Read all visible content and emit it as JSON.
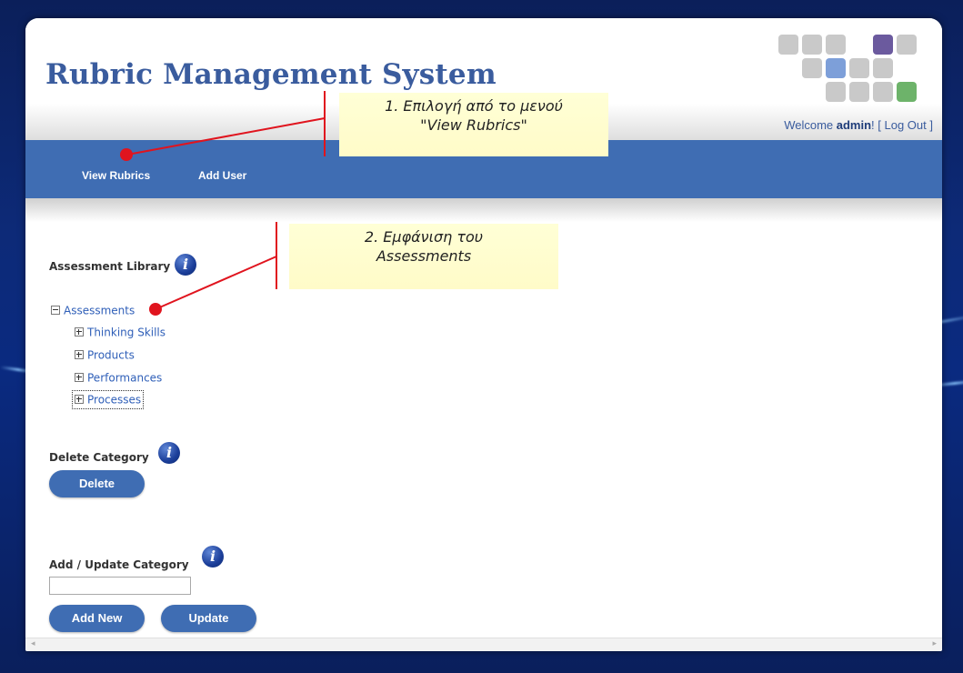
{
  "app": {
    "title": "Rubric Management System",
    "welcome_prefix": "Welcome ",
    "user": "admin",
    "welcome_sep": "! [ ",
    "logout_label": "Log Out",
    "welcome_suffix": " ]"
  },
  "nav": {
    "items": [
      {
        "label": "View Rubrics"
      },
      {
        "label": "Add User"
      }
    ]
  },
  "library": {
    "label": "Assessment Library",
    "tree_root": "Assessments",
    "tree_children": [
      "Thinking Skills",
      "Products",
      "Performances",
      "Processes"
    ]
  },
  "delete_category": {
    "label": "Delete Category",
    "button": "Delete"
  },
  "add_update_category": {
    "label": "Add / Update Category",
    "input_value": "",
    "add_button": "Add New",
    "update_button": "Update"
  },
  "annotations": {
    "step1": "1. Επιλογή από το μενού\n\"View Rubrics\"",
    "step2": "2. Εμφάνιση του\nAssessments"
  },
  "colors": {
    "brand_blue": "#3f6db3",
    "title_blue": "#3a5c9e",
    "annotation_red": "#e0141e",
    "callout_yellow": "#fffbc8"
  },
  "icons": {
    "info": "info-icon",
    "tree_collapse": "minus-box-icon",
    "tree_expand": "plus-box-icon"
  }
}
